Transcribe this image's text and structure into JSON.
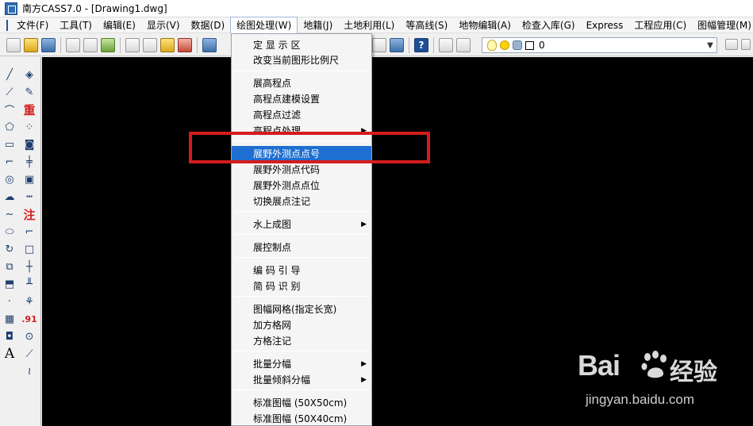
{
  "window": {
    "title": "南方CASS7.0 - [Drawing1.dwg]"
  },
  "menubar": {
    "items": [
      "文件(F)",
      "工具(T)",
      "编辑(E)",
      "显示(V)",
      "数据(D)",
      "绘图处理(W)",
      "地籍(J)",
      "土地利用(L)",
      "等高线(S)",
      "地物编辑(A)",
      "检查入库(G)",
      "Express",
      "工程应用(C)",
      "图幅管理(M)"
    ],
    "active_index": 5
  },
  "toolbar": {
    "layer_value": "0"
  },
  "lefttools": {
    "icons": [
      "line-icon",
      "polyline-icon",
      "arc-icon",
      "polygon-icon",
      "rectangle-icon",
      "curve-icon",
      "circle-icon",
      "cloud-icon",
      "spline-icon",
      "ellipse-icon",
      "rotate-icon",
      "block-icon",
      "point-icon",
      "hatch-icon",
      "region-icon",
      "text-icon"
    ],
    "labels": {
      "chong": "重",
      "zhu": "注",
      "dot91": ".91",
      "a": "A"
    }
  },
  "dropdown": {
    "items": [
      {
        "label": "定 显 示 区",
        "submenu": false
      },
      {
        "label": "改变当前图形比例尺",
        "submenu": false
      },
      {
        "label": "展高程点",
        "submenu": false
      },
      {
        "label": "高程点建模设置",
        "submenu": false
      },
      {
        "label": "高程点过滤",
        "submenu": false
      },
      {
        "label": "高程点处理",
        "submenu": true
      },
      {
        "label": "展野外测点点号",
        "submenu": false,
        "highlighted": true
      },
      {
        "label": "展野外测点代码",
        "submenu": false
      },
      {
        "label": "展野外测点点位",
        "submenu": false
      },
      {
        "label": "切换展点注记",
        "submenu": false
      },
      {
        "label": "水上成图",
        "submenu": true
      },
      {
        "label": "展控制点",
        "submenu": false
      },
      {
        "label": "编 码 引 导",
        "submenu": false
      },
      {
        "label": "简 码 识 别",
        "submenu": false
      },
      {
        "label": "图幅网格(指定长宽)",
        "submenu": false
      },
      {
        "label": "加方格网",
        "submenu": false
      },
      {
        "label": "方格注记",
        "submenu": false
      },
      {
        "label": "批量分幅",
        "submenu": true
      },
      {
        "label": "批量倾斜分幅",
        "submenu": true
      },
      {
        "label": "标准图幅 (50X50cm)",
        "submenu": false
      },
      {
        "label": "标准图幅 (50X40cm)",
        "submenu": false
      }
    ],
    "submenu_arrow": "▶"
  },
  "watermark": {
    "brand": "Bai",
    "brand2": "经验",
    "url": "jingyan.baidu.com"
  },
  "colors": {
    "highlight": "#1e6fd1",
    "red_box": "#d51c1c",
    "canvas": "#000000"
  }
}
